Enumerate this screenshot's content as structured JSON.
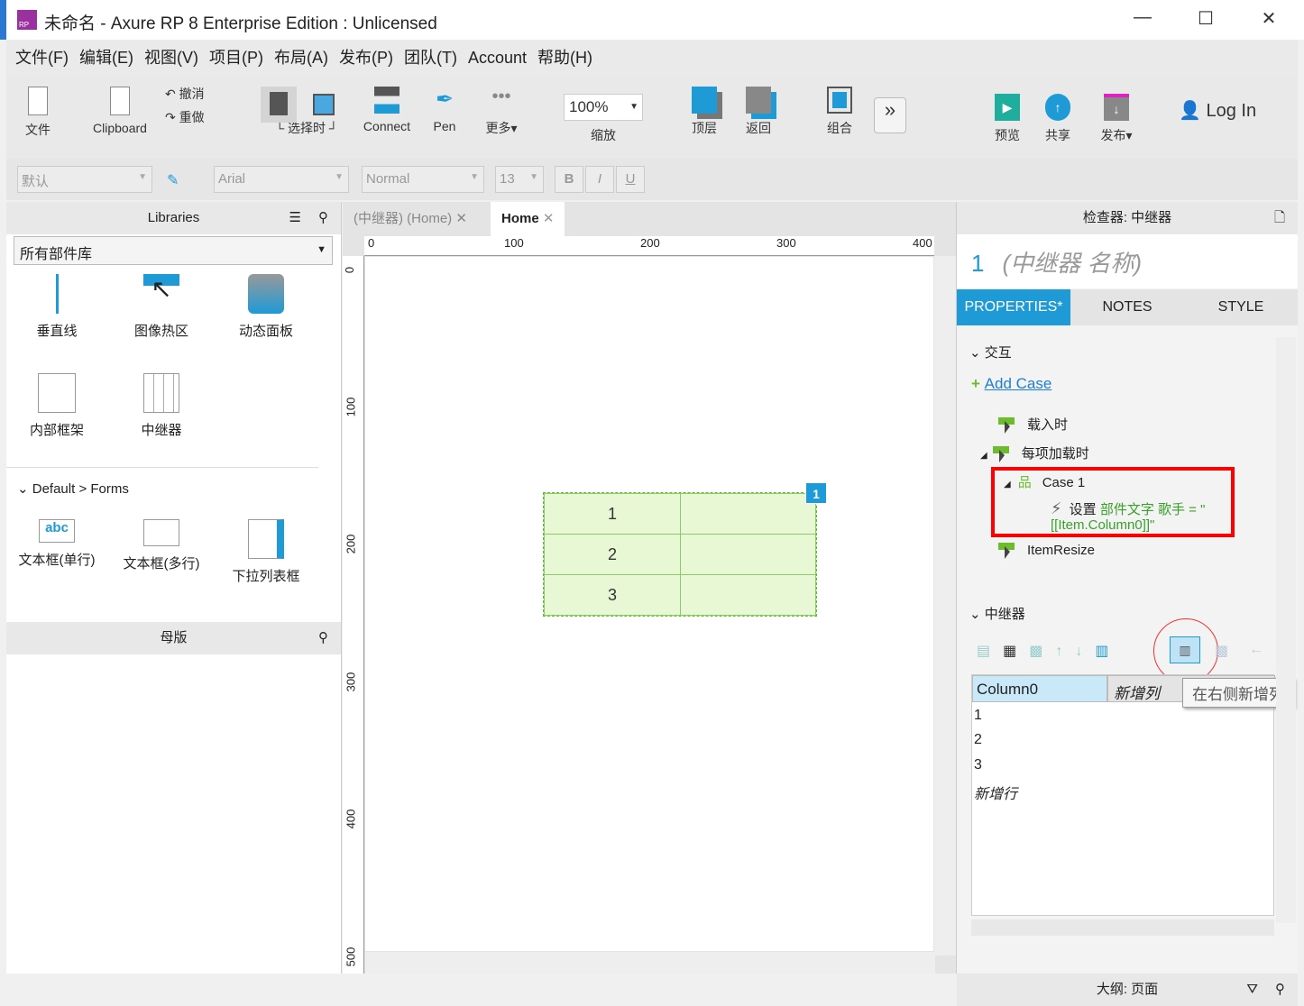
{
  "window": {
    "title": "未命名 - Axure RP 8 Enterprise Edition : Unlicensed",
    "minimize": "—",
    "maximize": "☐",
    "close": "✕"
  },
  "menu": [
    "文件(F)",
    "编辑(E)",
    "视图(V)",
    "项目(P)",
    "布局(A)",
    "发布(P)",
    "团队(T)",
    "Account",
    "帮助(H)"
  ],
  "toolbar": {
    "file": "文件",
    "clipboard": "Clipboard",
    "undo": "撤消",
    "redo": "重做",
    "select": "└ 选择时 ┘",
    "connect": "Connect",
    "pen": "Pen",
    "more": "更多▾",
    "zoom_value": "100%",
    "zoom_label": "缩放",
    "top": "顶层",
    "back": "返回",
    "group": "组合",
    "preview": "预览",
    "share": "共享",
    "publish": "发布▾",
    "login": "Log In"
  },
  "format": {
    "style": "默认",
    "font": "Arial",
    "weight": "Normal",
    "size": "13",
    "bold": "B",
    "italic": "I",
    "underline": "U"
  },
  "libraries": {
    "title": "Libraries",
    "selector": "所有部件库",
    "items": [
      "垂直线",
      "图像热区",
      "动态面板",
      "内部框架",
      "中继器"
    ],
    "section": "Default > Forms",
    "forms": [
      "文本框(单行)",
      "文本框(多行)",
      "下拉列表框"
    ],
    "masters_title": "母版"
  },
  "canvas": {
    "tabs": [
      "(中继器) (Home)",
      "Home"
    ],
    "ruler_x": [
      "0",
      "100",
      "200",
      "300",
      "400"
    ],
    "ruler_y": [
      "0",
      "100",
      "200",
      "300",
      "400",
      "500"
    ],
    "repeater_rows": [
      "1",
      "2",
      "3"
    ],
    "badge": "1"
  },
  "inspector": {
    "title": "检查器: 中继器",
    "widget_index": "1",
    "widget_name": "(中继器 名称)",
    "tabs": [
      "PROPERTIES*",
      "NOTES",
      "STYLE"
    ],
    "interaction_section": "交互",
    "add_case": "Add Case",
    "events": [
      "载入时",
      "每项加载时",
      "ItemResize"
    ],
    "case": "Case 1",
    "action_prefix": "设置",
    "action_detail": "部件文字 歌手 = \"[[Item.Column0]]\"",
    "repeater_section": "中继器",
    "columns": [
      "Column0",
      "新增列"
    ],
    "tooltip": "在右侧新增列",
    "rows": [
      "1",
      "2",
      "3",
      "新增行"
    ],
    "outline": "大纲: 页面",
    "accent": "#1e9ad6",
    "highlight": "#ff0000"
  }
}
